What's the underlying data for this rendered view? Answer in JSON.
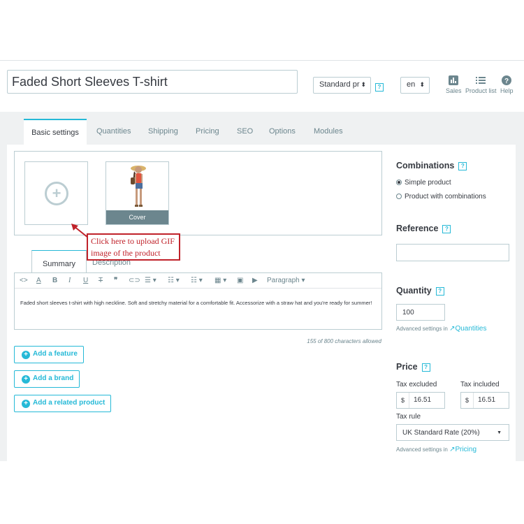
{
  "header": {
    "product_name": "Faded Short Sleeves T-shirt",
    "product_type": "Standard pr",
    "help": "?",
    "language": "en",
    "actions": [
      {
        "label": "Sales",
        "icon": "bar-chart-icon"
      },
      {
        "label": "Product list",
        "icon": "list-icon"
      },
      {
        "label": "Help",
        "icon": "help-circle-icon"
      }
    ]
  },
  "tabs": [
    "Basic settings",
    "Quantities",
    "Shipping",
    "Pricing",
    "SEO",
    "Options",
    "Modules"
  ],
  "images": {
    "cover_label": "Cover",
    "callout": "Click here to upload GIF image of the product"
  },
  "description": {
    "tabs": [
      "Summary",
      "Description"
    ],
    "toolbar_format": "Paragraph",
    "text": "Faded short sleeves t-shirt with high neckline. Soft and stretchy material for a comfortable fit. Accessorize with a straw hat and you're ready for summer!",
    "char_count": "155 of 800 characters allowed"
  },
  "buttons": {
    "add_feature": "Add a feature",
    "add_brand": "Add a brand",
    "add_related": "Add a related product"
  },
  "combinations": {
    "title": "Combinations",
    "options": [
      "Simple product",
      "Product with combinations"
    ],
    "selected": "Simple product"
  },
  "reference": {
    "title": "Reference",
    "value": ""
  },
  "quantity": {
    "title": "Quantity",
    "value": "100",
    "advanced_prefix": "Advanced settings in",
    "advanced_link": "Quantities"
  },
  "price": {
    "title": "Price",
    "tax_excluded_label": "Tax excluded",
    "tax_included_label": "Tax included",
    "currency": "$",
    "tax_excluded": "16.51",
    "tax_included": "16.51",
    "tax_rule_label": "Tax rule",
    "tax_rule": "UK Standard Rate (20%)",
    "advanced_prefix": "Advanced settings in",
    "advanced_link": "Pricing"
  },
  "colors": {
    "accent": "#25b9d7",
    "callout_red": "#c0222a",
    "border": "#bbcdd2",
    "band": "#eff1f2"
  }
}
